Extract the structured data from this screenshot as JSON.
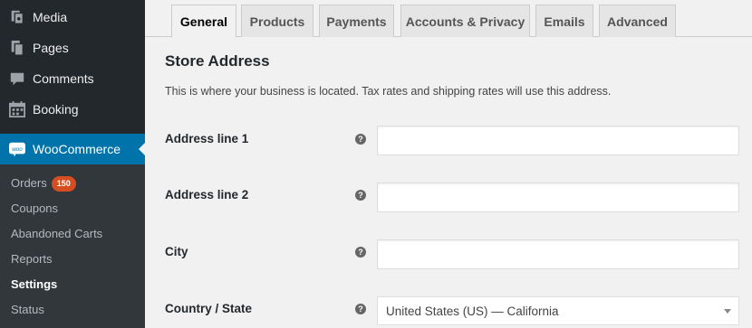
{
  "sidebar": {
    "menu": [
      {
        "label": "Media",
        "icon": "media-icon"
      },
      {
        "label": "Pages",
        "icon": "pages-icon"
      },
      {
        "label": "Comments",
        "icon": "comments-icon"
      },
      {
        "label": "Booking",
        "icon": "calendar-icon"
      },
      {
        "label": "WooCommerce",
        "icon": "woocommerce-icon"
      }
    ],
    "woo_logo_text": "woo",
    "submenu": [
      {
        "label": "Orders",
        "badge": "150"
      },
      {
        "label": "Coupons"
      },
      {
        "label": "Abandoned Carts"
      },
      {
        "label": "Reports"
      },
      {
        "label": "Settings"
      },
      {
        "label": "Status"
      }
    ]
  },
  "tabs": [
    "General",
    "Products",
    "Payments",
    "Accounts & Privacy",
    "Emails",
    "Advanced"
  ],
  "main": {
    "section_title": "Store Address",
    "description": "This is where your business is located. Tax rates and shipping rates will use this address.",
    "help_glyph": "?",
    "fields": [
      {
        "label": "Address line 1",
        "value": ""
      },
      {
        "label": "Address line 2",
        "value": ""
      },
      {
        "label": "City",
        "value": ""
      },
      {
        "label": "Country / State",
        "value": "United States (US) — California"
      }
    ]
  },
  "colors": {
    "sidebar_bg": "#23282d",
    "submenu_bg": "#32373c",
    "active_menu": "#0073aa",
    "badge": "#d54e21"
  }
}
